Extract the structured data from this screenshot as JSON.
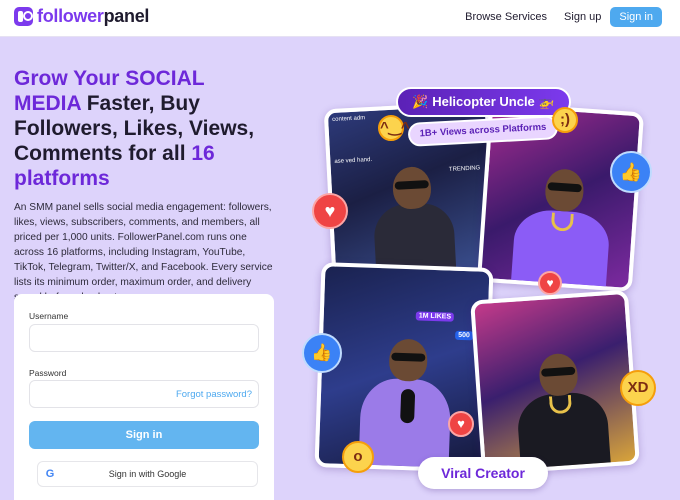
{
  "header": {
    "logo_part1": "follower",
    "logo_part2": "panel",
    "nav": {
      "browse": "Browse Services",
      "signup": "Sign up",
      "signin": "Sign in"
    }
  },
  "hero": {
    "title_hl1": "Grow Your SOCIAL MEDIA",
    "title_mid": " Faster, Buy Followers, Likes, Views, Comments for all ",
    "title_hl2": "16 platforms",
    "description": "An SMM panel sells social media engagement: followers, likes, views, subscribers, comments, and members, all priced per 1,000 units. FollowerPanel.com runs one across 16 platforms, including Instagram, YouTube, TikTok, Telegram, Twitter/X, and Facebook. Every service lists its minimum order, maximum order, and delivery speed before checkout."
  },
  "login": {
    "username_label": "Username",
    "username_value": "",
    "password_label": "Password",
    "password_value": "",
    "forgot": "Forgot password?",
    "signin_button": "Sign in",
    "google_button": "Sign in with Google"
  },
  "collage": {
    "title_badge": "🎉 Helicopter Uncle 🚁",
    "views_badge": "1B+ Views across Platforms",
    "viral_badge": "Viral Creator",
    "trending": "TRENDING",
    "likes_tag": "1M LIKES",
    "count_tag": "500",
    "caption1": "content adm",
    "caption2": "ase ved hand."
  },
  "colors": {
    "brand": "#7c3aed",
    "accent": "#4ea9ef",
    "background": "#ddd3fb"
  }
}
